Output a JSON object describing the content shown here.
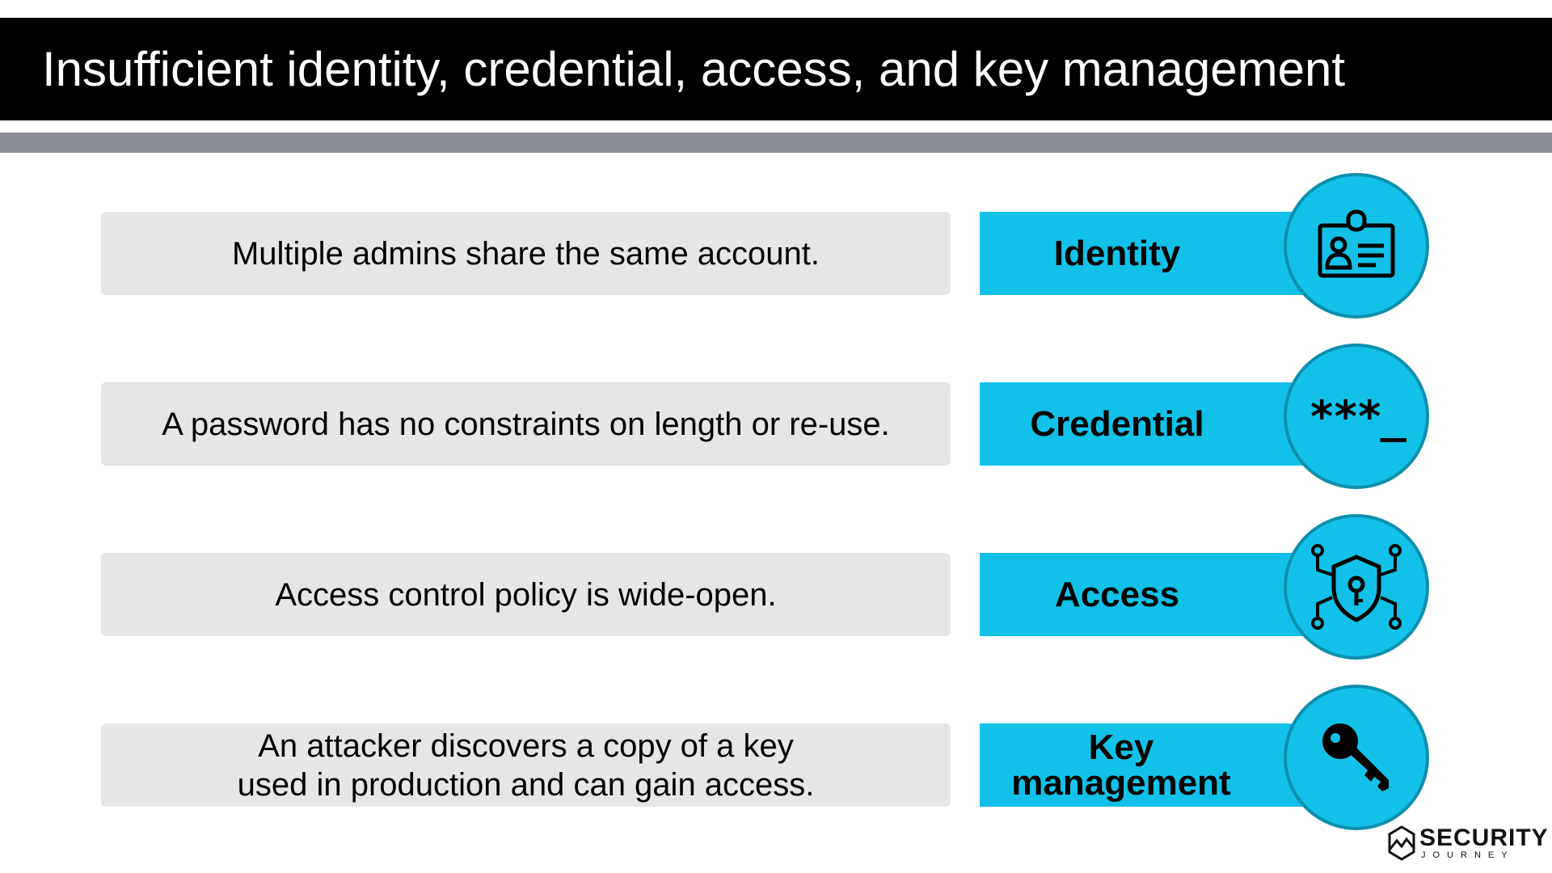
{
  "slide": {
    "title": "Insufficient identity, credential, access, and key management"
  },
  "rows": [
    {
      "description": "Multiple admins share the same account.",
      "tag": "Identity",
      "icon": "id-badge-icon"
    },
    {
      "description": "A password has no constraints on length or re-use.",
      "tag": "Credential",
      "icon": "password-field-icon",
      "icon_text": "***_"
    },
    {
      "description": "Access control policy is wide-open.",
      "tag": "Access",
      "icon": "shield-keyhole-network-icon"
    },
    {
      "description": "An attacker discovers a copy of a key used in production and can gain access.",
      "tag": "Key management",
      "icon": "key-icon"
    }
  ],
  "logo": {
    "word": "SECURITY",
    "subword": "JOURNEY"
  },
  "colors": {
    "header_bg": "#000000",
    "header_text": "#ffffff",
    "rule": "#898c95",
    "description_bg": "#e6e6e8",
    "accent": "#13c1e8",
    "accent_border": "#0c8fad"
  }
}
